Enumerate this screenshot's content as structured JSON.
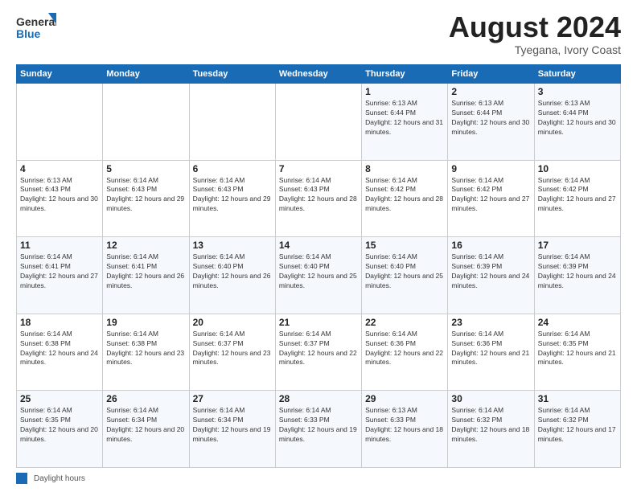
{
  "logo": {
    "line1": "General",
    "line2": "Blue"
  },
  "title": {
    "month_year": "August 2024",
    "location": "Tyegana, Ivory Coast"
  },
  "days_of_week": [
    "Sunday",
    "Monday",
    "Tuesday",
    "Wednesday",
    "Thursday",
    "Friday",
    "Saturday"
  ],
  "weeks": [
    [
      {
        "day": "",
        "info": ""
      },
      {
        "day": "",
        "info": ""
      },
      {
        "day": "",
        "info": ""
      },
      {
        "day": "",
        "info": ""
      },
      {
        "day": "1",
        "info": "Sunrise: 6:13 AM\nSunset: 6:44 PM\nDaylight: 12 hours and 31 minutes."
      },
      {
        "day": "2",
        "info": "Sunrise: 6:13 AM\nSunset: 6:44 PM\nDaylight: 12 hours and 30 minutes."
      },
      {
        "day": "3",
        "info": "Sunrise: 6:13 AM\nSunset: 6:44 PM\nDaylight: 12 hours and 30 minutes."
      }
    ],
    [
      {
        "day": "4",
        "info": "Sunrise: 6:13 AM\nSunset: 6:43 PM\nDaylight: 12 hours and 30 minutes."
      },
      {
        "day": "5",
        "info": "Sunrise: 6:14 AM\nSunset: 6:43 PM\nDaylight: 12 hours and 29 minutes."
      },
      {
        "day": "6",
        "info": "Sunrise: 6:14 AM\nSunset: 6:43 PM\nDaylight: 12 hours and 29 minutes."
      },
      {
        "day": "7",
        "info": "Sunrise: 6:14 AM\nSunset: 6:43 PM\nDaylight: 12 hours and 28 minutes."
      },
      {
        "day": "8",
        "info": "Sunrise: 6:14 AM\nSunset: 6:42 PM\nDaylight: 12 hours and 28 minutes."
      },
      {
        "day": "9",
        "info": "Sunrise: 6:14 AM\nSunset: 6:42 PM\nDaylight: 12 hours and 27 minutes."
      },
      {
        "day": "10",
        "info": "Sunrise: 6:14 AM\nSunset: 6:42 PM\nDaylight: 12 hours and 27 minutes."
      }
    ],
    [
      {
        "day": "11",
        "info": "Sunrise: 6:14 AM\nSunset: 6:41 PM\nDaylight: 12 hours and 27 minutes."
      },
      {
        "day": "12",
        "info": "Sunrise: 6:14 AM\nSunset: 6:41 PM\nDaylight: 12 hours and 26 minutes."
      },
      {
        "day": "13",
        "info": "Sunrise: 6:14 AM\nSunset: 6:40 PM\nDaylight: 12 hours and 26 minutes."
      },
      {
        "day": "14",
        "info": "Sunrise: 6:14 AM\nSunset: 6:40 PM\nDaylight: 12 hours and 25 minutes."
      },
      {
        "day": "15",
        "info": "Sunrise: 6:14 AM\nSunset: 6:40 PM\nDaylight: 12 hours and 25 minutes."
      },
      {
        "day": "16",
        "info": "Sunrise: 6:14 AM\nSunset: 6:39 PM\nDaylight: 12 hours and 24 minutes."
      },
      {
        "day": "17",
        "info": "Sunrise: 6:14 AM\nSunset: 6:39 PM\nDaylight: 12 hours and 24 minutes."
      }
    ],
    [
      {
        "day": "18",
        "info": "Sunrise: 6:14 AM\nSunset: 6:38 PM\nDaylight: 12 hours and 24 minutes."
      },
      {
        "day": "19",
        "info": "Sunrise: 6:14 AM\nSunset: 6:38 PM\nDaylight: 12 hours and 23 minutes."
      },
      {
        "day": "20",
        "info": "Sunrise: 6:14 AM\nSunset: 6:37 PM\nDaylight: 12 hours and 23 minutes."
      },
      {
        "day": "21",
        "info": "Sunrise: 6:14 AM\nSunset: 6:37 PM\nDaylight: 12 hours and 22 minutes."
      },
      {
        "day": "22",
        "info": "Sunrise: 6:14 AM\nSunset: 6:36 PM\nDaylight: 12 hours and 22 minutes."
      },
      {
        "day": "23",
        "info": "Sunrise: 6:14 AM\nSunset: 6:36 PM\nDaylight: 12 hours and 21 minutes."
      },
      {
        "day": "24",
        "info": "Sunrise: 6:14 AM\nSunset: 6:35 PM\nDaylight: 12 hours and 21 minutes."
      }
    ],
    [
      {
        "day": "25",
        "info": "Sunrise: 6:14 AM\nSunset: 6:35 PM\nDaylight: 12 hours and 20 minutes."
      },
      {
        "day": "26",
        "info": "Sunrise: 6:14 AM\nSunset: 6:34 PM\nDaylight: 12 hours and 20 minutes."
      },
      {
        "day": "27",
        "info": "Sunrise: 6:14 AM\nSunset: 6:34 PM\nDaylight: 12 hours and 19 minutes."
      },
      {
        "day": "28",
        "info": "Sunrise: 6:14 AM\nSunset: 6:33 PM\nDaylight: 12 hours and 19 minutes."
      },
      {
        "day": "29",
        "info": "Sunrise: 6:13 AM\nSunset: 6:33 PM\nDaylight: 12 hours and 18 minutes."
      },
      {
        "day": "30",
        "info": "Sunrise: 6:14 AM\nSunset: 6:32 PM\nDaylight: 12 hours and 18 minutes."
      },
      {
        "day": "31",
        "info": "Sunrise: 6:14 AM\nSunset: 6:32 PM\nDaylight: 12 hours and 17 minutes."
      }
    ]
  ],
  "footer": {
    "label": "Daylight hours"
  }
}
